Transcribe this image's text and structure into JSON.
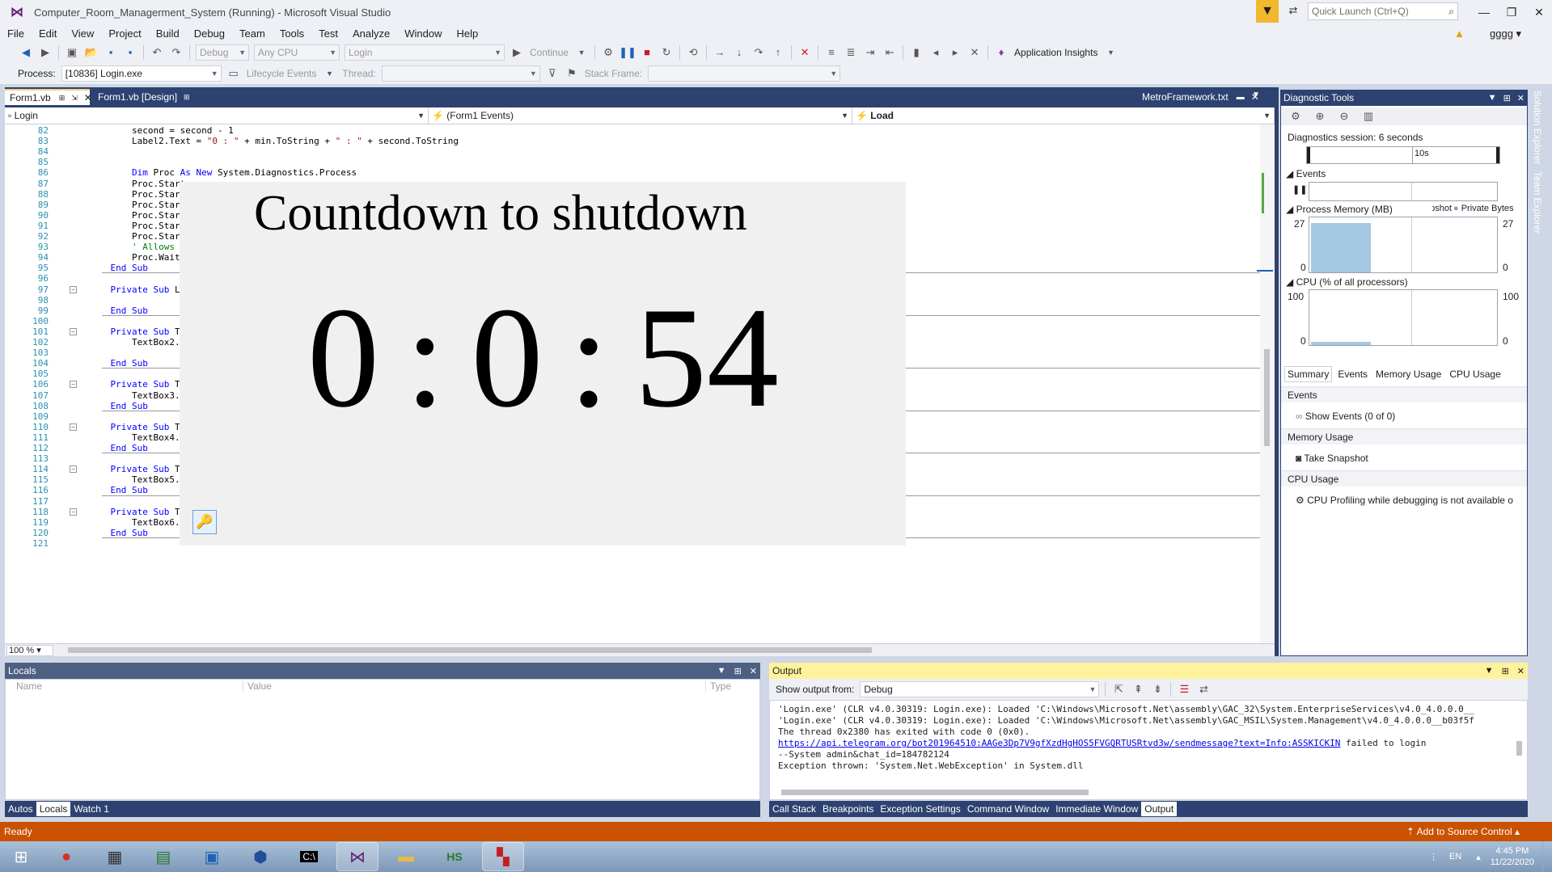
{
  "window": {
    "title": "Computer_Room_Managerment_System (Running) - Microsoft Visual Studio",
    "quick_launch_placeholder": "Quick Launch (Ctrl+Q)",
    "user": "gggg"
  },
  "menu": [
    "File",
    "Edit",
    "View",
    "Project",
    "Build",
    "Debug",
    "Team",
    "Tools",
    "Test",
    "Analyze",
    "Window",
    "Help"
  ],
  "toolbar1": {
    "config": "Debug",
    "platform": "Any CPU",
    "startup": "Login",
    "continue_label": "Continue",
    "app_insights": "Application Insights"
  },
  "toolbar2": {
    "process_label": "Process:",
    "process_value": "[10836] Login.exe",
    "lifecycle_label": "Lifecycle Events",
    "thread_label": "Thread:",
    "stack_frame_label": "Stack Frame:"
  },
  "doc_tabs": {
    "form1_vb": "Form1.vb",
    "form1_design": "Form1.vb [Design]",
    "metro": "MetroFramework.txt"
  },
  "navbar": {
    "project": "Login",
    "events": "(Form1 Events)",
    "method": "Load"
  },
  "editor": {
    "zoom": "100 %",
    "lines": [
      {
        "n": "82",
        "code": "        second = second - 1"
      },
      {
        "n": "83",
        "code": "        Label2.Text = \"0 : \" + min.ToString + \" : \" + second.ToString"
      },
      {
        "n": "84",
        "code": ""
      },
      {
        "n": "85",
        "code": ""
      },
      {
        "n": "86",
        "code": "        Dim Proc As New System.Diagnostics.Process"
      },
      {
        "n": "87",
        "code": "        Proc.Start"
      },
      {
        "n": "88",
        "code": "        Proc.Start"
      },
      {
        "n": "89",
        "code": "        Proc.Start"
      },
      {
        "n": "90",
        "code": "        Proc.Start"
      },
      {
        "n": "91",
        "code": "        Proc.Start"
      },
      {
        "n": "92",
        "code": "        Proc.Start"
      },
      {
        "n": "93",
        "code": "        ' Allows s"
      },
      {
        "n": "94",
        "code": "        Proc.WaitF"
      },
      {
        "n": "95",
        "code": "    End Sub"
      },
      {
        "n": "96",
        "code": ""
      },
      {
        "n": "97",
        "code": "    Private Sub La"
      },
      {
        "n": "98",
        "code": ""
      },
      {
        "n": "99",
        "code": "    End Sub"
      },
      {
        "n": "100",
        "code": ""
      },
      {
        "n": "101",
        "code": "    Private Sub Te"
      },
      {
        "n": "102",
        "code": "        TextBox2.F"
      },
      {
        "n": "103",
        "code": ""
      },
      {
        "n": "104",
        "code": "    End Sub"
      },
      {
        "n": "105",
        "code": ""
      },
      {
        "n": "106",
        "code": "    Private Sub Te"
      },
      {
        "n": "107",
        "code": "        TextBox3.F"
      },
      {
        "n": "108",
        "code": "    End Sub"
      },
      {
        "n": "109",
        "code": ""
      },
      {
        "n": "110",
        "code": "    Private Sub Te"
      },
      {
        "n": "111",
        "code": "        TextBox4.F"
      },
      {
        "n": "112",
        "code": "    End Sub"
      },
      {
        "n": "113",
        "code": ""
      },
      {
        "n": "114",
        "code": "    Private Sub TextBox4_TextChanged(sender As Object, e As EventArgs) Handles TextBox4.TextChanged"
      },
      {
        "n": "115",
        "code": "        TextBox5.Focus()"
      },
      {
        "n": "116",
        "code": "    End Sub"
      },
      {
        "n": "117",
        "code": ""
      },
      {
        "n": "118",
        "code": "    Private Sub TextBox5_TextChanged(sender As Object, e As EventArgs) Handles TextBox5.TextChanged"
      },
      {
        "n": "119",
        "code": "        TextBox6.Focus()"
      },
      {
        "n": "120",
        "code": "    End Sub"
      },
      {
        "n": "121",
        "code": ""
      }
    ]
  },
  "countdown": {
    "title": "Countdown to shutdown",
    "hours": "0",
    "minutes": "0",
    "seconds": "54",
    "separator": ":"
  },
  "diagnostics": {
    "title": "Diagnostic Tools",
    "session": "Diagnostics session: 6 seconds",
    "timeline_label": "10s",
    "events_label": "Events",
    "process_memory_label": "Process Memory (MB)",
    "snapshot_label": "Snapshot",
    "private_bytes_label": "Private Bytes",
    "mem_max": "27",
    "mem_min": "0",
    "cpu_label": "CPU (% of all processors)",
    "cpu_max": "100",
    "cpu_min": "0",
    "tabs": [
      "Summary",
      "Events",
      "Memory Usage",
      "CPU Usage"
    ],
    "section_events": "Events",
    "show_events": "Show Events (0 of 0)",
    "section_memory": "Memory Usage",
    "take_snapshot": "Take Snapshot",
    "section_cpu": "CPU Usage",
    "cpu_profiling": "CPU Profiling while debugging is not available o"
  },
  "side_tabs": [
    "Solution Explorer",
    "Team Explorer"
  ],
  "locals": {
    "title": "Locals",
    "col_name": "Name",
    "col_value": "Value",
    "col_type": "Type",
    "tabs": [
      "Autos",
      "Locals",
      "Watch 1"
    ]
  },
  "output": {
    "title": "Output",
    "show_from_label": "Show output from:",
    "show_from_value": "Debug",
    "line1": "'Login.exe' (CLR v4.0.30319: Login.exe): Loaded 'C:\\Windows\\Microsoft.Net\\assembly\\GAC_32\\System.EnterpriseServices\\v4.0_4.0.0.0__",
    "line2": "'Login.exe' (CLR v4.0.30319: Login.exe): Loaded 'C:\\Windows\\Microsoft.Net\\assembly\\GAC_MSIL\\System.Management\\v4.0_4.0.0.0__b03f5f",
    "line3": "The thread 0x2380 has exited with code 0 (0x0).",
    "line4_link": "https://api.telegram.org/bot201964510:AAGe3Dp7V9gfXzdHgHOS5FVGQRTUSRtvd3w/sendmessage?text=Info:ASSKICKIN",
    "line4_tail": " failed to login",
    "line5": "--System admin&chat_id=184782124",
    "line6": "Exception thrown: 'System.Net.WebException' in System.dll",
    "tabs": [
      "Call Stack",
      "Breakpoints",
      "Exception Settings",
      "Command Window",
      "Immediate Window",
      "Output"
    ]
  },
  "status": {
    "left": "Ready",
    "right": "Add to Source Control"
  },
  "taskbar": {
    "lang": "EN",
    "time": "4:45 PM",
    "date": "11/22/2020"
  },
  "colors": {
    "vs_frame": "#2d4270",
    "status_orange": "#ca5100",
    "output_header": "#fff29d"
  }
}
